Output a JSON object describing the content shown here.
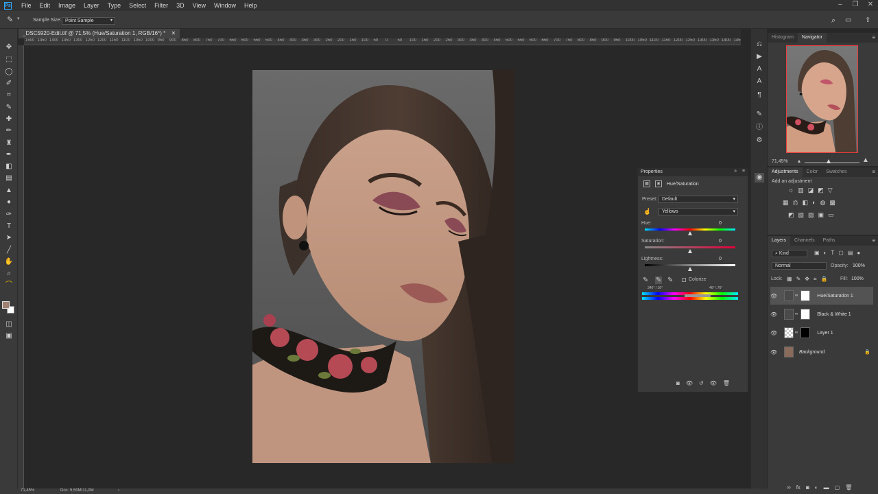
{
  "menubar": {
    "items": [
      "File",
      "Edit",
      "Image",
      "Layer",
      "Type",
      "Select",
      "Filter",
      "3D",
      "View",
      "Window",
      "Help"
    ]
  },
  "options": {
    "sample_size_label": "Sample Size:",
    "sample_size_value": "Point Sample"
  },
  "document": {
    "tab_title": "_DSC5920-Edit.tif @ 71,5% (Hue/Saturation 1, RGB/16*) *",
    "ruler_labels": [
      "1500",
      "1450",
      "1400",
      "1350",
      "1300",
      "1250",
      "1200",
      "1150",
      "1100",
      "1050",
      "1000",
      "950",
      "900",
      "850",
      "800",
      "750",
      "700",
      "650",
      "600",
      "550",
      "500",
      "450",
      "400",
      "350",
      "300",
      "250",
      "200",
      "150",
      "100",
      "50",
      "0",
      "50",
      "100",
      "150",
      "200",
      "250",
      "300",
      "350",
      "400",
      "450",
      "500",
      "550",
      "600",
      "650",
      "700",
      "750",
      "800",
      "850",
      "900",
      "950",
      "1000",
      "1050",
      "1100",
      "1150",
      "1200",
      "1250",
      "1300",
      "1350",
      "1400",
      "1450"
    ]
  },
  "status": {
    "zoom": "71,45%",
    "doc": "Doc: 5,50M/11,0M"
  },
  "navigator": {
    "tabs": [
      "Histogram",
      "Navigator"
    ],
    "zoom": "71,45%"
  },
  "adjustments": {
    "tabs": [
      "Adjustments",
      "Color",
      "Swatches"
    ],
    "hint": "Add an adjustment"
  },
  "properties": {
    "title": "Properties",
    "adj_name": "Hue/Saturation",
    "preset_label": "Preset:",
    "preset_value": "Default",
    "channel_value": "Yellows",
    "hue_label": "Hue:",
    "hue_value": "0",
    "saturation_label": "Saturation:",
    "saturation_value": "0",
    "lightness_label": "Lightness:",
    "lightness_value": "0",
    "colorize_label": "Colorize",
    "range_left": "346° / 16°",
    "range_right": "46° \\ 76°",
    "hue_pos": 0.5,
    "saturation_pos": 0.5,
    "lightness_pos": 0.5
  },
  "layers": {
    "tabs": [
      "Layers",
      "Channels",
      "Paths"
    ],
    "filter": "Kind",
    "blend_mode": "Normal",
    "opacity_label": "Opacity:",
    "opacity_value": "100%",
    "lock_label": "Lock:",
    "fill_label": "Fill:",
    "fill_value": "100%",
    "items": [
      {
        "name": "Hue/Saturation 1",
        "selected": true
      },
      {
        "name": "Black & White 1",
        "selected": false
      },
      {
        "name": "Layer 1",
        "selected": false
      },
      {
        "name": "Background",
        "selected": false
      }
    ]
  },
  "colors": {
    "foreground": "#a08070",
    "background": "#ffffff",
    "accent": "#31a8ff",
    "nav_frame": "#e83c3c"
  }
}
